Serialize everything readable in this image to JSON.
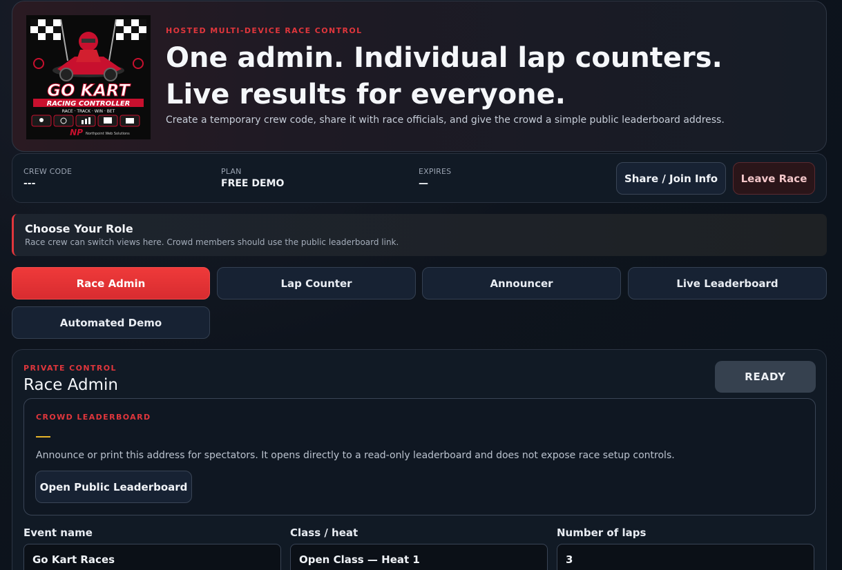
{
  "hero": {
    "logo": {
      "brand_line1": "GO KART",
      "brand_line2": "RACING CONTROLLER",
      "tagline": "RACE · TRACK · WIN · BET",
      "company_initials": "NP",
      "company_name": "Northpoint Web Solutions"
    },
    "eyebrow": "HOSTED MULTI-DEVICE RACE CONTROL",
    "title": "One admin. Individual lap counters. Live results for everyone.",
    "subtitle": "Create a temporary crew code, share it with race officials, and give the crowd a simple public leaderboard address."
  },
  "info_bar": {
    "crew_code_label": "CREW CODE",
    "crew_code_value": "---",
    "plan_label": "PLAN",
    "plan_value": "FREE DEMO",
    "expires_label": "EXPIRES",
    "expires_value": "—",
    "share_button": "Share / Join Info",
    "leave_button": "Leave Race"
  },
  "role_section": {
    "title": "Choose Your Role",
    "subtitle": "Race crew can switch views here. Crowd members should use the public leaderboard link."
  },
  "tabs": [
    {
      "label": "Race Admin",
      "active": true
    },
    {
      "label": "Lap Counter",
      "active": false
    },
    {
      "label": "Announcer",
      "active": false
    },
    {
      "label": "Live Leaderboard",
      "active": false
    },
    {
      "label": "Automated Demo",
      "active": false
    }
  ],
  "panel": {
    "eyebrow": "PRIVATE CONTROL",
    "title": "Race Admin",
    "status": "READY",
    "crowd": {
      "eyebrow": "CROWD LEADERBOARD",
      "text": "Announce or print this address for spectators. It opens directly to a read-only leaderboard and does not expose race setup controls.",
      "button": "Open Public Leaderboard"
    },
    "fields": {
      "event_name_label": "Event name",
      "event_name_value": "Go Kart Races",
      "class_label": "Class / heat",
      "class_value": "Open Class — Heat 1",
      "laps_label": "Number of laps",
      "laps_value": "3"
    }
  },
  "colors": {
    "accent": "#e0363c",
    "accent_active": "#ef3a3a",
    "highlight": "#e8b52a",
    "background": "#0e141d"
  }
}
